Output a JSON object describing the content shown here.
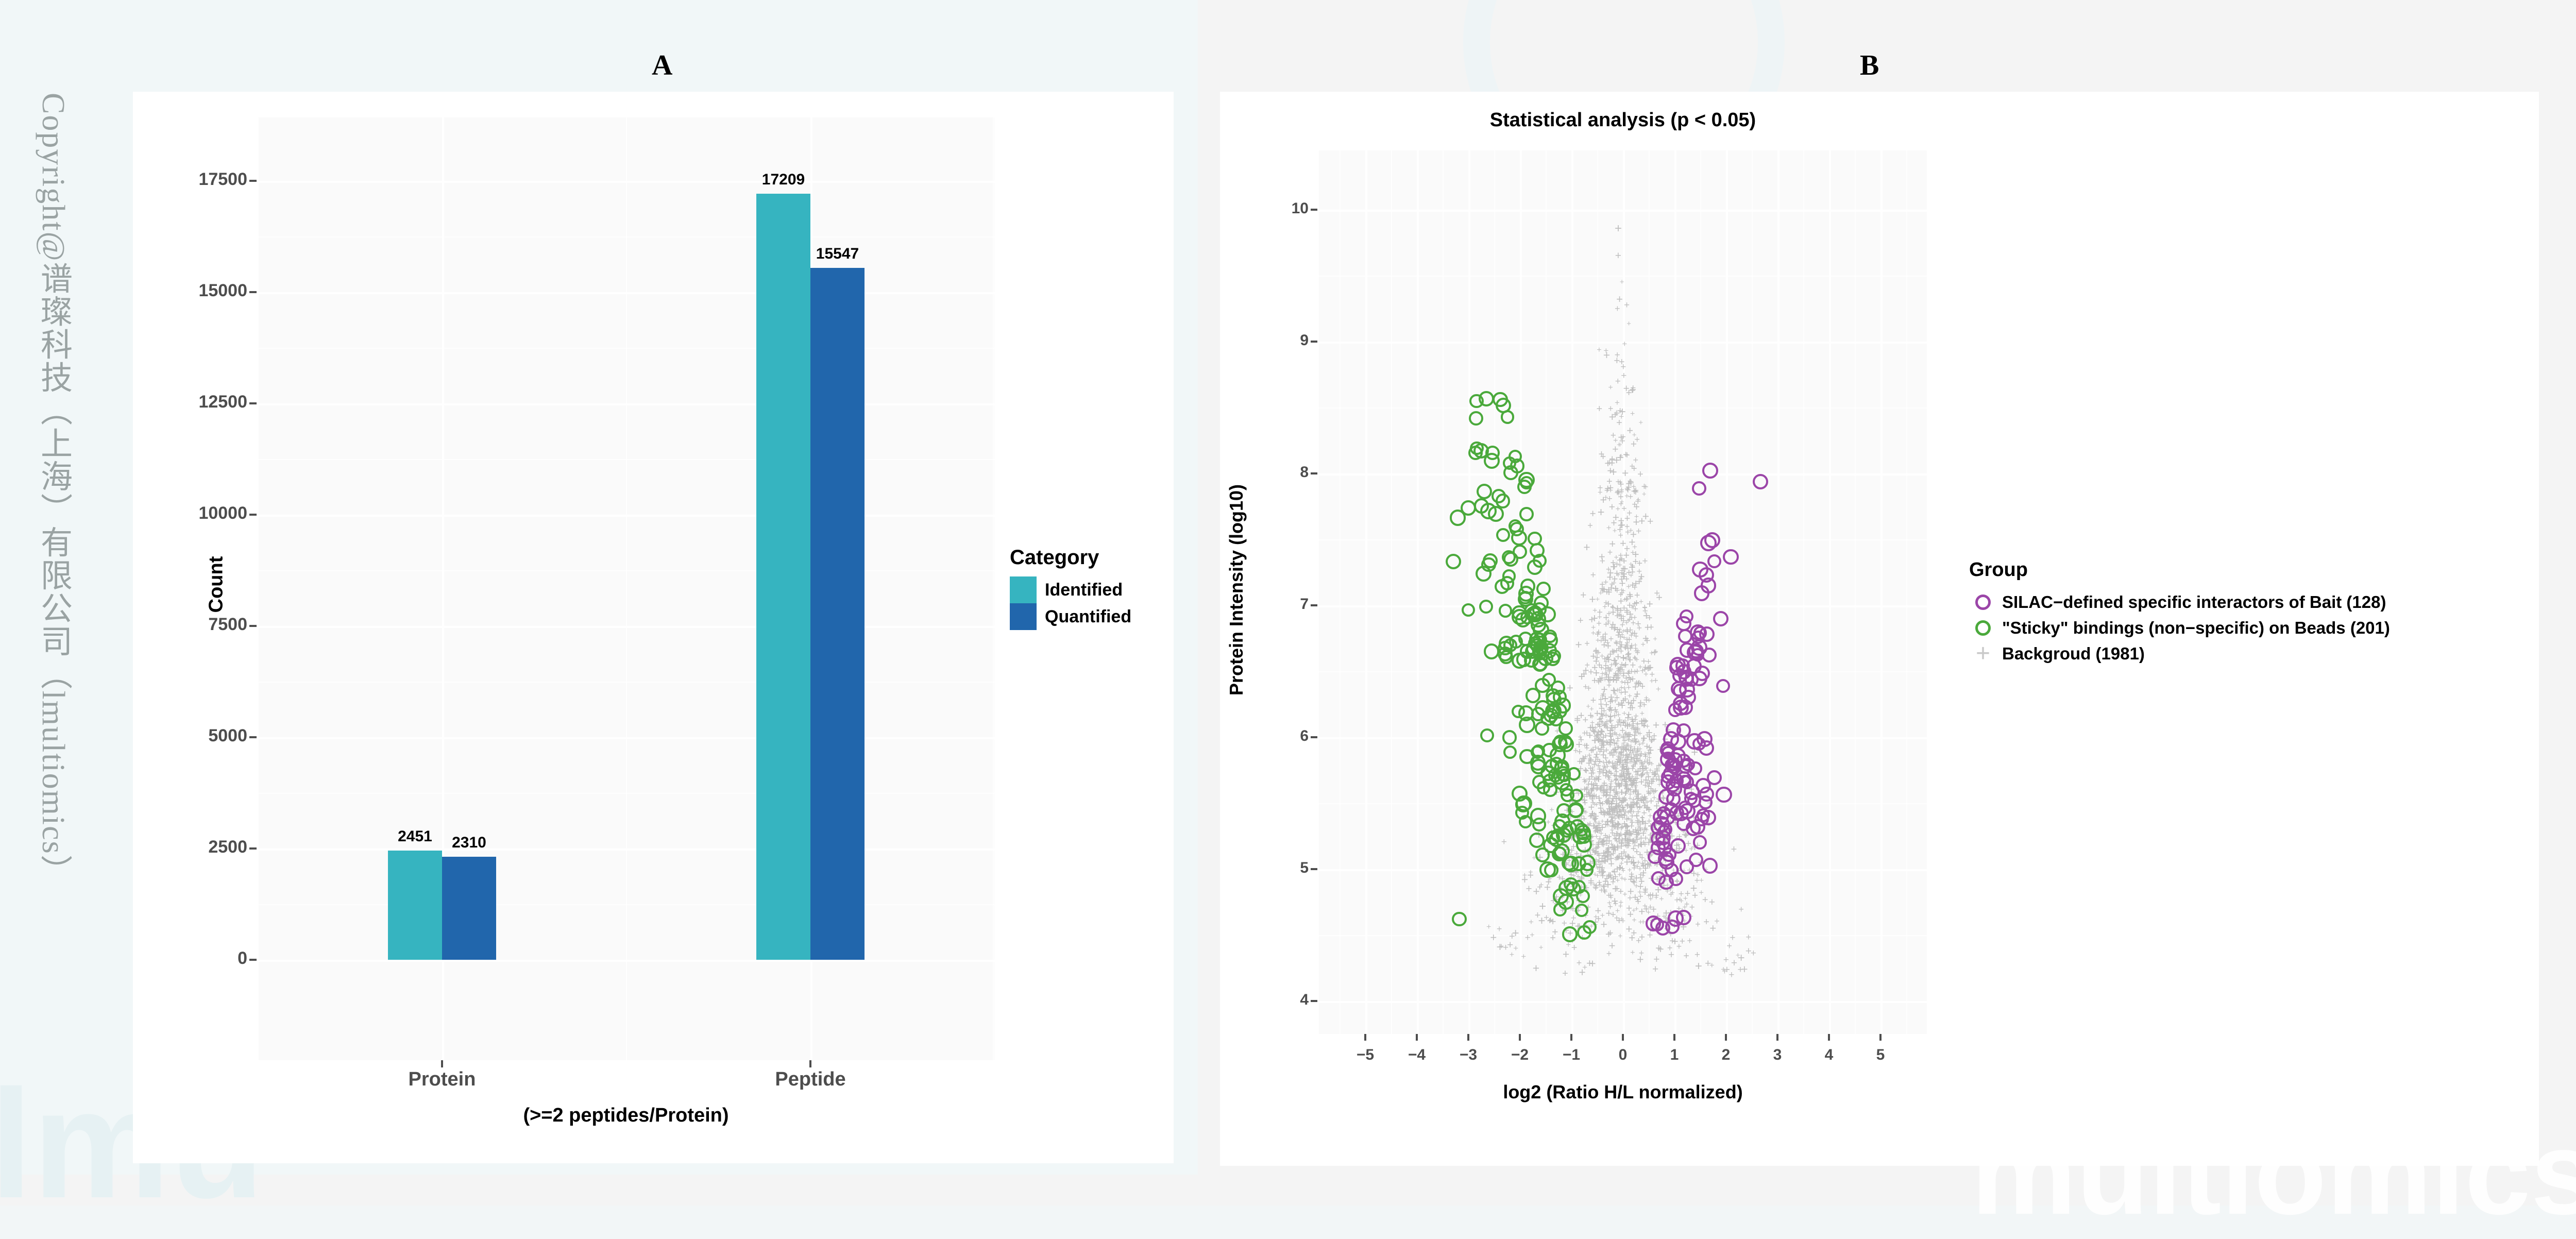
{
  "figure": {
    "panel_a_letter": "A",
    "panel_b_letter": "B",
    "watermark_vertical": "Copyright@谱璨科技（上海）有限公司（lmultiomics）",
    "watermark_left": "lmu",
    "watermark_right": "multiomics"
  },
  "panel_a": {
    "legend_title": "Category",
    "legend_items": [
      {
        "label": "Identified",
        "color": "#36b4c0"
      },
      {
        "label": "Quantified",
        "color": "#2166ac"
      }
    ]
  },
  "panel_b": {
    "legend_title": "Group",
    "legend_items": [
      {
        "label": "SILAC−defined specific interactors of Bait (128)",
        "color": "#9b45a8",
        "marker": "circle"
      },
      {
        "label": "\"Sticky\" bindings (non−specific) on Beads (201)",
        "color": "#4aa93b",
        "marker": "circle"
      },
      {
        "label": "Backgroud (1981)",
        "color": "#c9c9c9",
        "marker": "plus"
      }
    ]
  },
  "chart_data": [
    {
      "type": "bar",
      "panel": "A",
      "title": "",
      "xlabel": "(>=2 peptides/Protein)",
      "ylabel": "Count",
      "categories": [
        "Protein",
        "Peptide"
      ],
      "series": [
        {
          "name": "Identified",
          "color": "#36b4c0",
          "values": [
            2451,
            17209
          ]
        },
        {
          "name": "Quantified",
          "color": "#2166ac",
          "values": [
            2310,
            15547
          ]
        }
      ],
      "ylim": [
        0,
        18600
      ],
      "yticks": [
        0,
        2500,
        5000,
        7500,
        10000,
        12500,
        15000,
        17500
      ],
      "ytick_labels": [
        "0",
        "2500",
        "5000",
        "7500",
        "10000",
        "12500",
        "15000",
        "17500"
      ],
      "bar_labels": [
        [
          "2451",
          "2310"
        ],
        [
          "17209",
          "15547"
        ]
      ],
      "grid": true,
      "legend_position": "right"
    },
    {
      "type": "scatter",
      "panel": "B",
      "title": "Statistical analysis (p < 0.05)",
      "xlabel": "log2 (Ratio H/L normalized)",
      "ylabel": "Protein Intensity (log10)",
      "xlim": [
        -5.9,
        5.9
      ],
      "ylim": [
        3.75,
        10.45
      ],
      "xticks": [
        -5,
        -4,
        -3,
        -2,
        -1,
        0,
        1,
        2,
        3,
        4,
        5
      ],
      "xtick_labels": [
        "−5",
        "−4",
        "−3",
        "−2",
        "−1",
        "0",
        "1",
        "2",
        "3",
        "4",
        "5"
      ],
      "yticks": [
        4,
        5,
        6,
        7,
        8,
        9,
        10
      ],
      "ytick_labels": [
        "4",
        "5",
        "6",
        "7",
        "8",
        "9",
        "10"
      ],
      "grid": true,
      "legend_position": "right",
      "series": [
        {
          "name": "Backgroud (1981)",
          "color": "#c9c9c9",
          "marker": "plus",
          "count": 1981
        },
        {
          "name": "\"Sticky\" bindings (non−specific) on Beads (201)",
          "color": "#4aa93b",
          "marker": "circle",
          "count": 201
        },
        {
          "name": "SILAC−defined specific interactors of Bait (128)",
          "color": "#9b45a8",
          "marker": "circle",
          "count": 128
        }
      ]
    }
  ]
}
